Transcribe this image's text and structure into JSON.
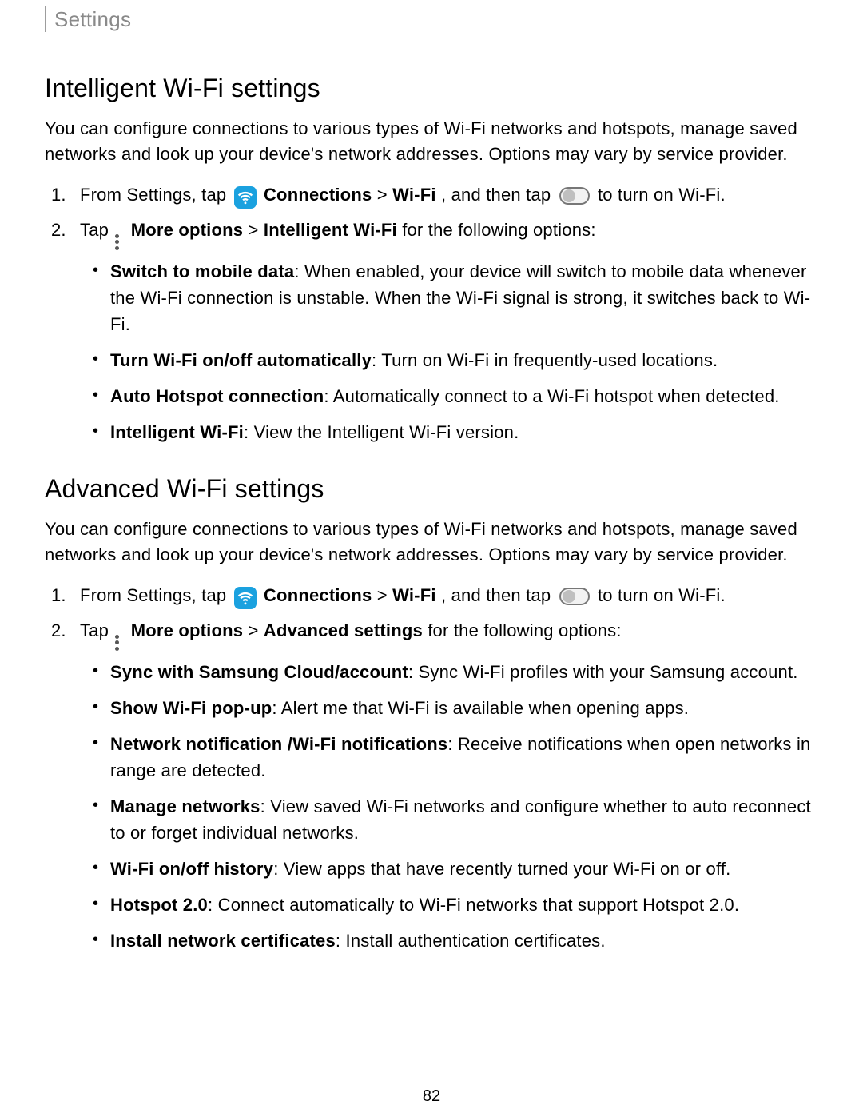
{
  "breadcrumb": "Settings",
  "pageNumber": "82",
  "sections": [
    {
      "heading": "Intelligent Wi-Fi settings",
      "intro": "You can configure connections to various types of Wi-Fi networks and hotspots, manage saved networks and look up your device's network addresses. Options may vary by service provider.",
      "step1": {
        "num": "1.",
        "pre": "From Settings, tap ",
        "connections": "Connections",
        "gt1": " > ",
        "wifi": "Wi-Fi",
        "mid": ", and then tap ",
        "post": " to turn on Wi-Fi."
      },
      "step2": {
        "num": "2.",
        "pre": "Tap ",
        "more": "More options",
        "gt": " > ",
        "sub": "Intelligent Wi-Fi",
        "post": " for the following options:"
      },
      "bullets": [
        {
          "label": "Switch to mobile data",
          "text": ": When enabled, your device will switch to mobile data whenever the Wi-Fi connection is unstable. When the Wi-Fi signal is strong, it switches back to Wi-Fi."
        },
        {
          "label": "Turn Wi-Fi on/off automatically",
          "text": ": Turn on Wi-Fi in frequently-used locations."
        },
        {
          "label": "Auto Hotspot connection",
          "text": ": Automatically connect to a Wi-Fi hotspot when detected."
        },
        {
          "label": "Intelligent Wi-Fi",
          "text": ": View the Intelligent Wi-Fi version."
        }
      ]
    },
    {
      "heading": "Advanced Wi-Fi settings",
      "intro": "You can configure connections to various types of Wi-Fi networks and hotspots, manage saved networks and look up your device's network addresses. Options may vary by service provider.",
      "step1": {
        "num": "1.",
        "pre": "From Settings, tap ",
        "connections": "Connections",
        "gt1": " > ",
        "wifi": "Wi-Fi",
        "mid": ", and then tap ",
        "post": " to turn on Wi-Fi."
      },
      "step2": {
        "num": "2.",
        "pre": "Tap ",
        "more": "More options",
        "gt": " > ",
        "sub": "Advanced settings",
        "post": " for the following options:"
      },
      "bullets": [
        {
          "label": "Sync with Samsung Cloud/account",
          "text": ": Sync Wi-Fi profiles with your Samsung account."
        },
        {
          "label": "Show Wi-Fi pop-up",
          "text": ": Alert me that Wi-Fi is available when opening apps."
        },
        {
          "label": "Network notification /Wi-Fi notifications",
          "text": ": Receive notifications when open networks in range are detected."
        },
        {
          "label": "Manage networks",
          "text": ": View saved Wi-Fi networks and configure whether to auto reconnect to or forget individual networks."
        },
        {
          "label": "Wi-Fi on/off history",
          "text": ": View apps that have recently turned your Wi-Fi on or off."
        },
        {
          "label": "Hotspot 2.0",
          "text": ": Connect automatically to Wi-Fi networks that support Hotspot 2.0."
        },
        {
          "label": "Install network certificates",
          "text": ": Install authentication certificates."
        }
      ]
    }
  ]
}
